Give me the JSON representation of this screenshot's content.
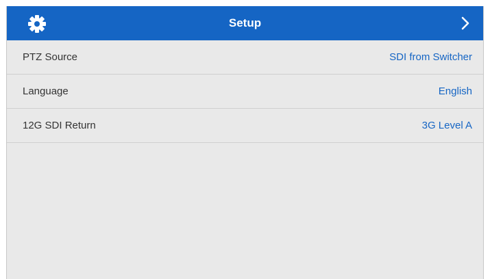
{
  "header": {
    "title": "Setup",
    "settings_icon": "gear-icon",
    "next_icon": "chevron-right-icon"
  },
  "rows": [
    {
      "label": "PTZ Source",
      "value": "SDI from Switcher"
    },
    {
      "label": "Language",
      "value": "English"
    },
    {
      "label": "12G SDI Return",
      "value": "3G Level A"
    }
  ],
  "colors": {
    "header_bg": "#1565c4",
    "accent_text": "#1565c4",
    "panel_bg": "#e9e9e9"
  }
}
